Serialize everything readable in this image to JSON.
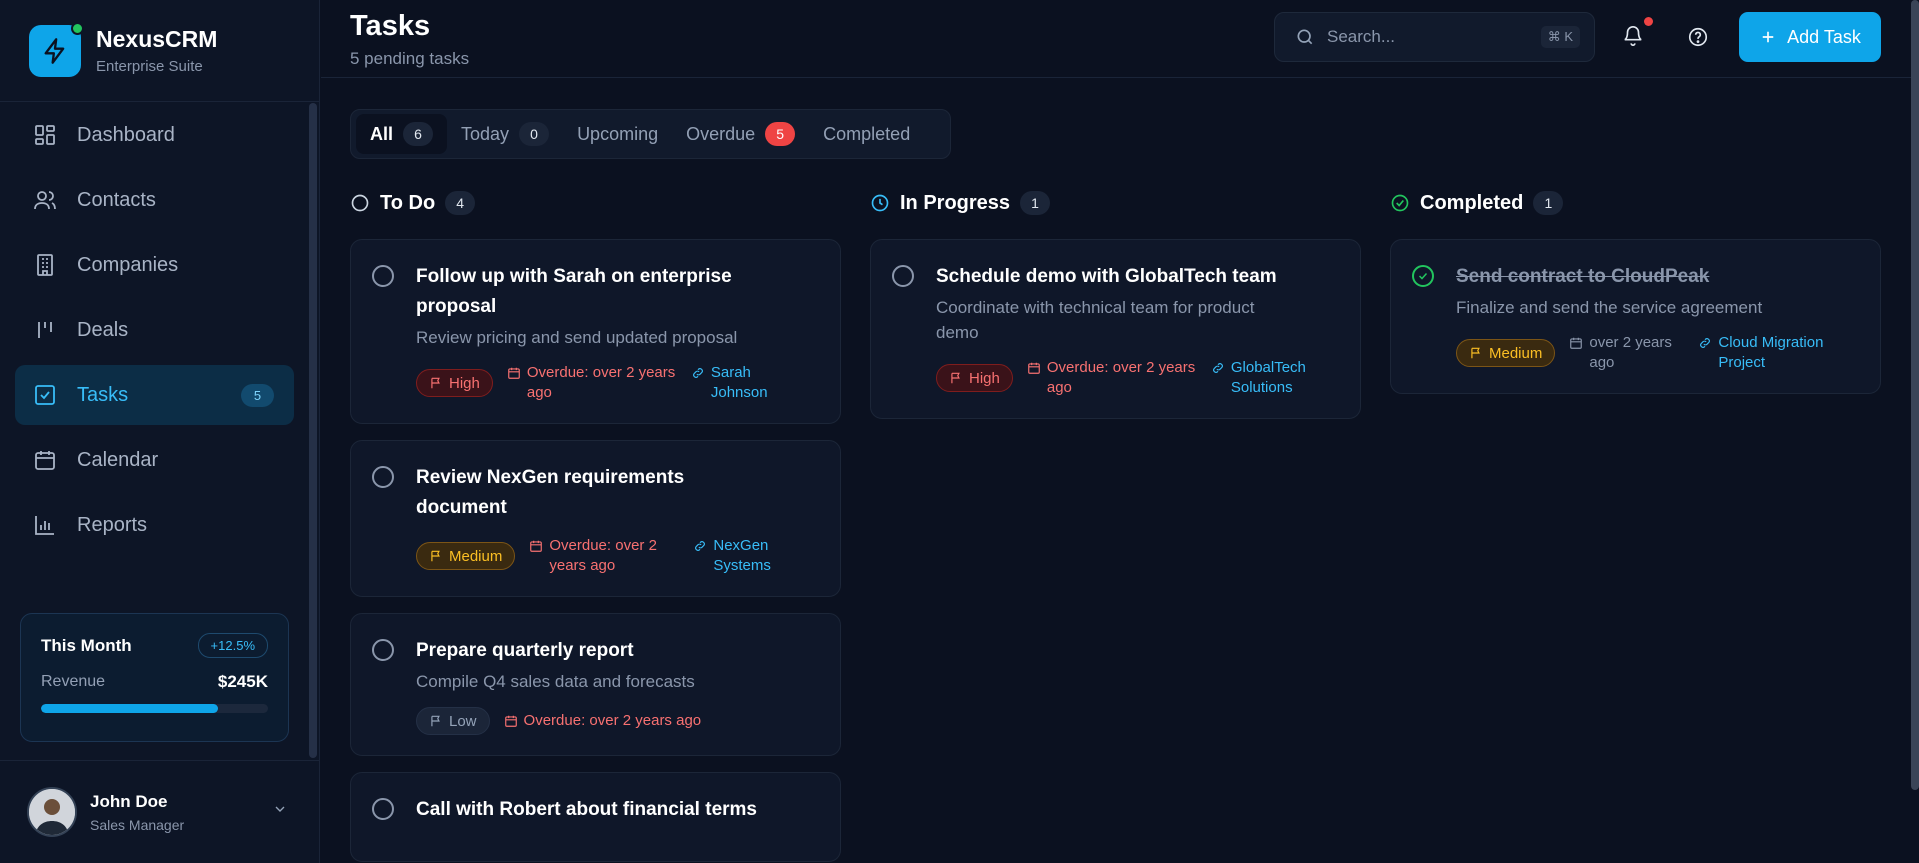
{
  "brand": {
    "name": "NexusCRM",
    "subtitle": "Enterprise Suite"
  },
  "nav": [
    {
      "label": "Dashboard",
      "icon": "dashboard-icon"
    },
    {
      "label": "Contacts",
      "icon": "contacts-icon"
    },
    {
      "label": "Companies",
      "icon": "companies-icon"
    },
    {
      "label": "Deals",
      "icon": "deals-icon"
    },
    {
      "label": "Tasks",
      "icon": "tasks-icon",
      "badge": "5",
      "active": true
    },
    {
      "label": "Calendar",
      "icon": "calendar-icon"
    },
    {
      "label": "Reports",
      "icon": "reports-icon"
    }
  ],
  "month_card": {
    "title": "This Month",
    "growth": "+12.5%",
    "label": "Revenue",
    "value": "$245K",
    "progress": 0.78
  },
  "user": {
    "name": "John Doe",
    "role": "Sales Manager"
  },
  "header": {
    "title": "Tasks",
    "subtitle": "5 pending tasks",
    "search_placeholder": "Search...",
    "shortcut": "⌘ K",
    "add_label": "Add Task"
  },
  "tabs": [
    {
      "label": "All",
      "count": "6",
      "active": true
    },
    {
      "label": "Today",
      "count": "0"
    },
    {
      "label": "Upcoming"
    },
    {
      "label": "Overdue",
      "count": "5",
      "red": true
    },
    {
      "label": "Completed"
    }
  ],
  "columns": [
    {
      "title": "To Do",
      "count": "4",
      "icon": "circle-icon",
      "cards": [
        {
          "title": "Follow up with Sarah on enterprise proposal",
          "desc": "Review pricing and send updated proposal",
          "priority": "High",
          "due": "Overdue: over 2 years ago",
          "link": "Sarah Johnson"
        },
        {
          "title": "Review NexGen requirements document",
          "desc": "",
          "priority": "Medium",
          "due": "Overdue: over 2 years ago",
          "link": "NexGen Systems"
        },
        {
          "title": "Prepare quarterly report",
          "desc": "Compile Q4 sales data and forecasts",
          "priority": "Low",
          "due": "Overdue: over 2 years ago",
          "link": ""
        },
        {
          "title": "Call with Robert about financial terms",
          "desc": "",
          "priority": "",
          "due": "",
          "link": ""
        }
      ]
    },
    {
      "title": "In Progress",
      "count": "1",
      "icon": "clock-icon",
      "cards": [
        {
          "title": "Schedule demo with GlobalTech team",
          "desc": "Coordinate with technical team for product demo",
          "priority": "High",
          "due": "Overdue: over 2 years ago",
          "link": "GlobalTech Solutions"
        }
      ]
    },
    {
      "title": "Completed",
      "count": "1",
      "icon": "check-circle-icon",
      "cards": [
        {
          "title": "Send contract to CloudPeak",
          "desc": "Finalize and send the service agreement",
          "priority": "Medium",
          "due": "over 2 years ago",
          "link": "Cloud Migration Project",
          "done": true
        }
      ]
    }
  ]
}
